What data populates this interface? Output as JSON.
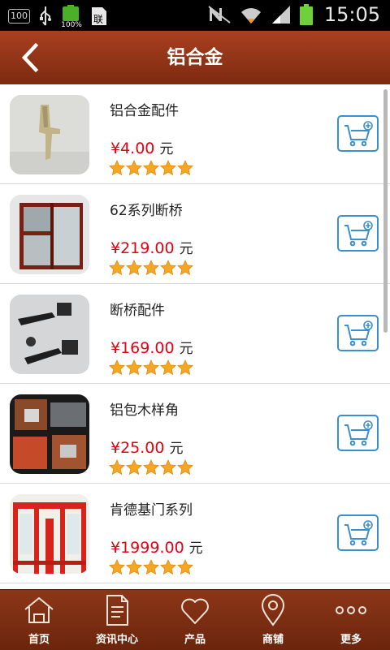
{
  "status_bar": {
    "left_badge": "100",
    "battery_small_text": "100%",
    "sim_text": "联",
    "time": "15:05"
  },
  "header": {
    "title": "铝合金",
    "back_icon": "chevron-left-icon"
  },
  "products": [
    {
      "name": "铝合金配件",
      "price": "¥4.00",
      "unit": "元",
      "rating": 5,
      "thumb": "window-handle"
    },
    {
      "name": "62系列断桥",
      "price": "¥219.00",
      "unit": "元",
      "rating": 5,
      "thumb": "window-frame"
    },
    {
      "name": "断桥配件",
      "price": "¥169.00",
      "unit": "元",
      "rating": 5,
      "thumb": "black-handles"
    },
    {
      "name": "铝包木样角",
      "price": "¥25.00",
      "unit": "元",
      "rating": 5,
      "thumb": "wood-corner"
    },
    {
      "name": "肯德基门系列",
      "price": "¥1999.00",
      "unit": "元",
      "rating": 5,
      "thumb": "red-door"
    }
  ],
  "bottom_nav": [
    {
      "label": "首页",
      "icon": "home-icon"
    },
    {
      "label": "资讯中心",
      "icon": "document-icon"
    },
    {
      "label": "产品",
      "icon": "heart-icon"
    },
    {
      "label": "商铺",
      "icon": "location-pin-icon"
    },
    {
      "label": "更多",
      "icon": "more-dots-icon"
    }
  ],
  "colors": {
    "header_bg": "#8f3315",
    "price": "#e60012",
    "cart_border": "#3b8fd0",
    "star": "#f5a623"
  }
}
